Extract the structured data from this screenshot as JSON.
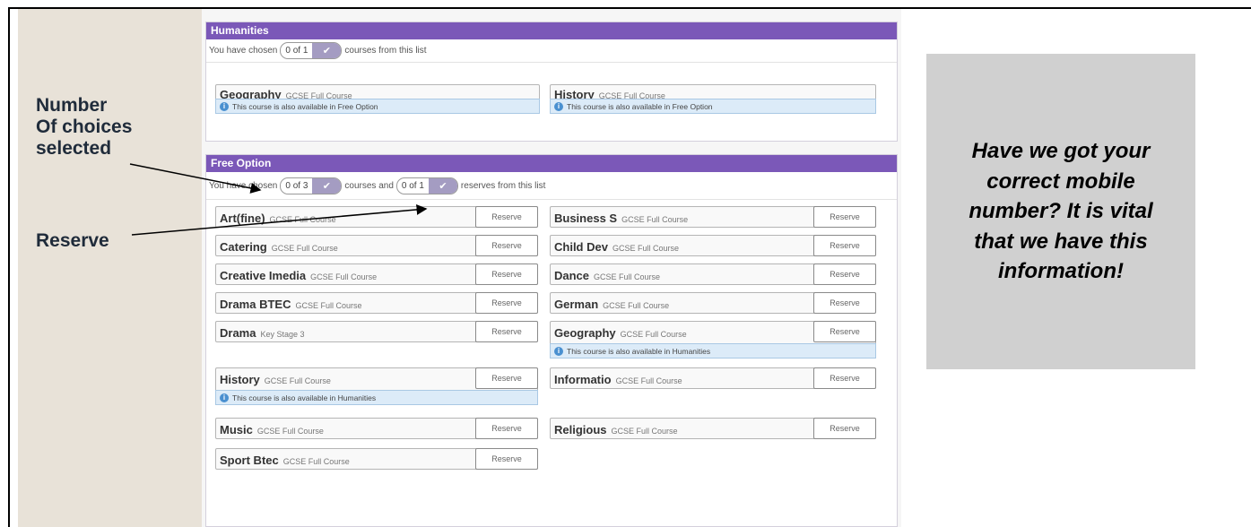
{
  "annotations": {
    "number_choices_line1": "Number",
    "number_choices_line2": "Of choices",
    "number_choices_line3": "selected",
    "reserve": "Reserve"
  },
  "humanities": {
    "title": "Humanities",
    "chosen_prefix": "You have chosen",
    "chosen_count": "0 of 1",
    "chosen_suffix": "courses from this list",
    "courses": [
      {
        "name": "Geography",
        "type": "GCSE Full Course",
        "info": "This course is also available in Free Option"
      },
      {
        "name": "History",
        "type": "GCSE Full Course",
        "info": "This course is also available in Free Option"
      }
    ]
  },
  "free_option": {
    "title": "Free Option",
    "chosen_prefix": "You have chosen",
    "chosen_count": "0 of 3",
    "chosen_middle": "courses and",
    "reserves_count": "0 of 1",
    "chosen_suffix": "reserves from this list",
    "reserve_label": "Reserve",
    "courses": [
      {
        "name": "Art(fine)",
        "type": "GCSE Full Course"
      },
      {
        "name": "Business S",
        "type": "GCSE Full Course"
      },
      {
        "name": "Catering",
        "type": "GCSE Full Course"
      },
      {
        "name": "Child Dev",
        "type": "GCSE Full Course"
      },
      {
        "name": "Creative Imedia",
        "type": "GCSE Full Course"
      },
      {
        "name": "Dance",
        "type": "GCSE Full Course"
      },
      {
        "name": "Drama BTEC",
        "type": "GCSE Full Course"
      },
      {
        "name": "German",
        "type": "GCSE Full Course"
      },
      {
        "name": "Drama",
        "type": "Key Stage 3"
      },
      {
        "name": "Geography",
        "type": "GCSE Full Course",
        "info": "This course is also available in Humanities"
      },
      {
        "name": "History",
        "type": "GCSE Full Course",
        "info": "This course is also available in Humanities"
      },
      {
        "name": "Informatio",
        "type": "GCSE Full Course"
      },
      {
        "name": "Music",
        "type": "GCSE Full Course"
      },
      {
        "name": "Religious",
        "type": "GCSE Full Course"
      },
      {
        "name": "Sport Btec",
        "type": "GCSE Full Course"
      }
    ]
  },
  "callout": {
    "text": "Have we got your correct mobile number? It is vital that we have this information!"
  },
  "colors": {
    "header_purple": "#7b58b8",
    "check_button": "#a49cc2",
    "info_blue": "#dcebf8",
    "annotation_panel": "#e8e2d8",
    "callout_bg": "#d0d0d0"
  }
}
